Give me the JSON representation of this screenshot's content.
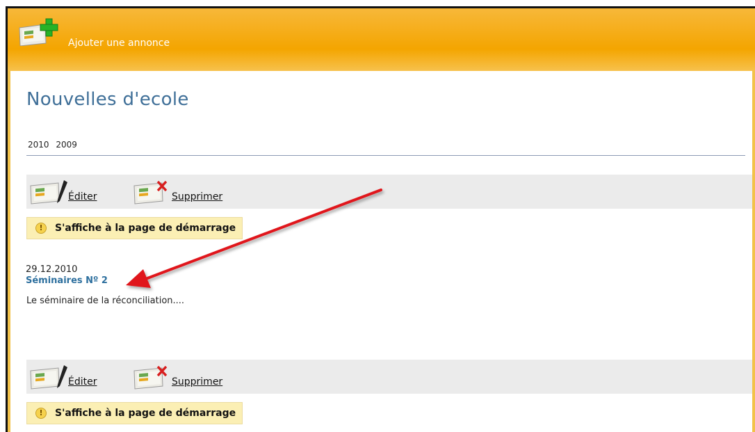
{
  "header": {
    "add_label": "Ajouter une annonce",
    "add_icon": "image-plus-icon"
  },
  "page": {
    "title": "Nouvelles d'ecole"
  },
  "years": [
    "2010",
    "2009"
  ],
  "actions": {
    "edit_label": "Éditer",
    "delete_label": "Supprimer",
    "edit_icon": "image-pen-icon",
    "delete_icon": "image-x-icon"
  },
  "badge": {
    "label": "S'affiche à la page de démarrage",
    "icon": "warning-icon"
  },
  "posts": [
    {
      "date": "29.12.2010",
      "title": "Séminaires Nº 2",
      "excerpt": "Le séminaire de la réconciliation...."
    }
  ],
  "colors": {
    "header": "#f4a500",
    "title": "#3f6f98",
    "link": "#2d6f9e",
    "badge_bg": "#fbefb4",
    "annotation_arrow": "#e0191b"
  }
}
